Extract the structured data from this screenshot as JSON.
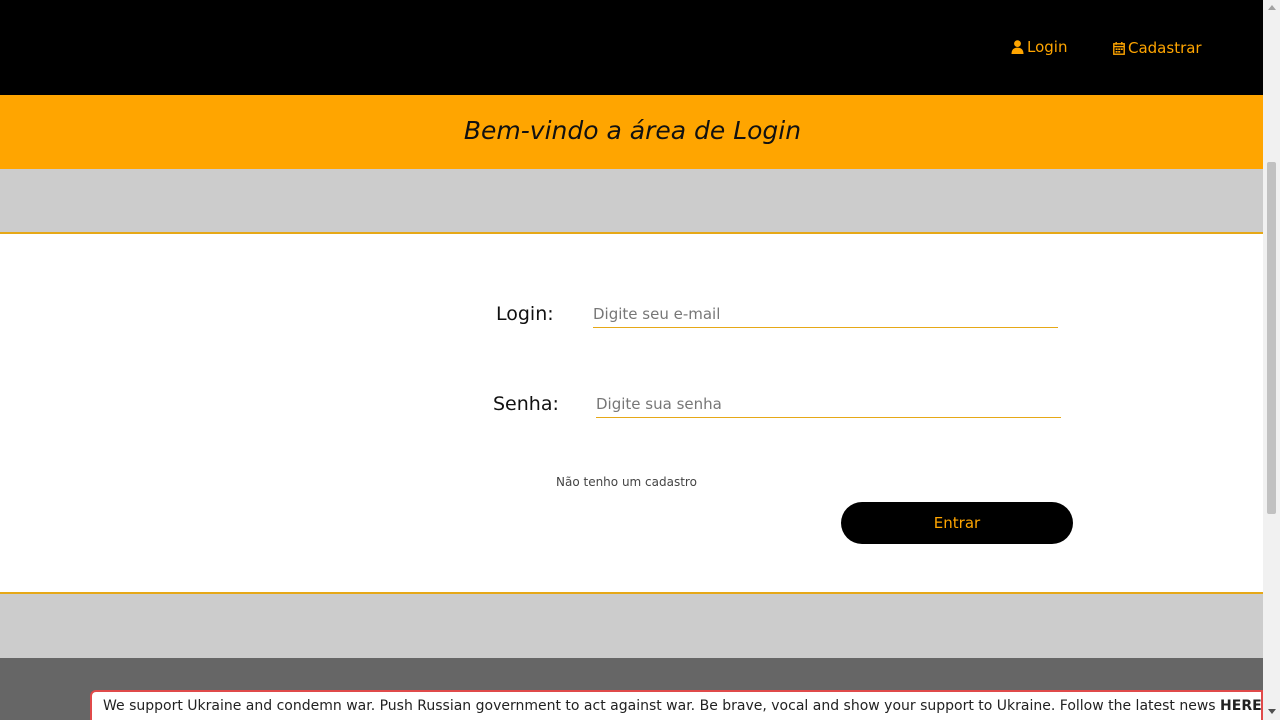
{
  "nav": {
    "login_label": "Login",
    "register_label": "Cadastrar",
    "login_icon": "user-icon",
    "register_icon": "calendar-icon"
  },
  "banner": {
    "title": "Bem-vindo a área de Login"
  },
  "form": {
    "login_label": "Login:",
    "login_placeholder": "Digite seu e-mail",
    "password_label": "Senha:",
    "password_placeholder": "Digite sua senha",
    "register_link": "Não tenho um cadastro",
    "submit_label": "Entrar"
  },
  "notice": {
    "text": "We support Ukraine and condemn war. Push Russian government to act against war. Be brave, vocal and show your support to Ukraine. Follow the latest news ",
    "link_label": "HERE"
  },
  "colors": {
    "accent": "#ffa500",
    "header_bg": "#000000",
    "band_gray": "#cccccc",
    "footer_gray": "#666666",
    "notice_border": "#e04a4a"
  }
}
